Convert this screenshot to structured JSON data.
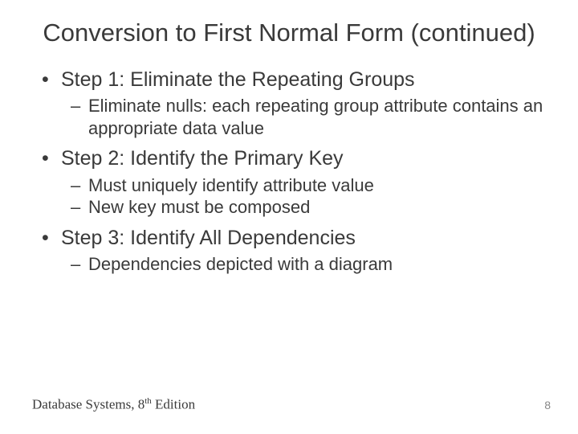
{
  "title": "Conversion to First Normal Form (continued)",
  "steps": [
    {
      "label": "Step 1: Eliminate the Repeating Groups",
      "subs": [
        "Eliminate nulls: each repeating group attribute contains an appropriate data value"
      ]
    },
    {
      "label": "Step 2: Identify the Primary Key",
      "subs": [
        "Must uniquely identify attribute value",
        "New key must be composed"
      ]
    },
    {
      "label": "Step 3: Identify All Dependencies",
      "subs": [
        "Dependencies depicted with a diagram"
      ]
    }
  ],
  "footer": {
    "book": "Database Systems, 8",
    "ordinal": "th",
    "edition": " Edition",
    "page": "8"
  }
}
